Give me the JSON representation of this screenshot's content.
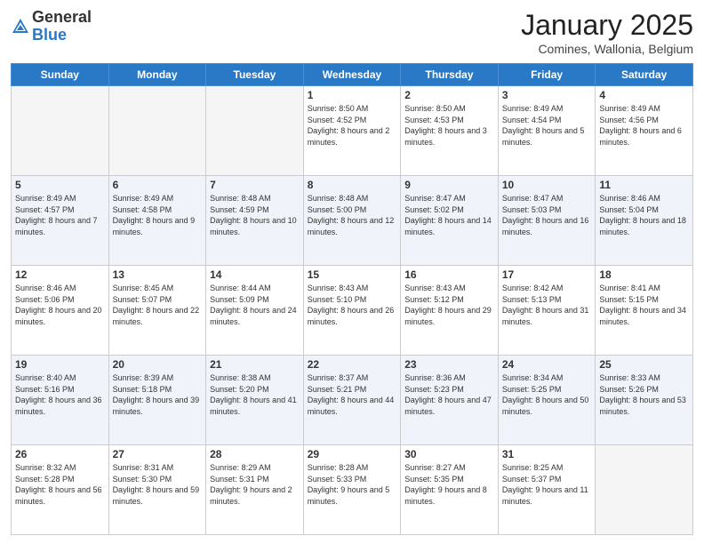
{
  "logo": {
    "general": "General",
    "blue": "Blue"
  },
  "title": "January 2025",
  "subtitle": "Comines, Wallonia, Belgium",
  "days_of_week": [
    "Sunday",
    "Monday",
    "Tuesday",
    "Wednesday",
    "Thursday",
    "Friday",
    "Saturday"
  ],
  "weeks": [
    [
      {
        "day": "",
        "empty": true
      },
      {
        "day": "",
        "empty": true
      },
      {
        "day": "",
        "empty": true
      },
      {
        "day": "1",
        "sunrise": "8:50 AM",
        "sunset": "4:52 PM",
        "daylight": "8 hours and 2 minutes."
      },
      {
        "day": "2",
        "sunrise": "8:50 AM",
        "sunset": "4:53 PM",
        "daylight": "8 hours and 3 minutes."
      },
      {
        "day": "3",
        "sunrise": "8:49 AM",
        "sunset": "4:54 PM",
        "daylight": "8 hours and 5 minutes."
      },
      {
        "day": "4",
        "sunrise": "8:49 AM",
        "sunset": "4:56 PM",
        "daylight": "8 hours and 6 minutes."
      }
    ],
    [
      {
        "day": "5",
        "sunrise": "8:49 AM",
        "sunset": "4:57 PM",
        "daylight": "8 hours and 7 minutes."
      },
      {
        "day": "6",
        "sunrise": "8:49 AM",
        "sunset": "4:58 PM",
        "daylight": "8 hours and 9 minutes."
      },
      {
        "day": "7",
        "sunrise": "8:48 AM",
        "sunset": "4:59 PM",
        "daylight": "8 hours and 10 minutes."
      },
      {
        "day": "8",
        "sunrise": "8:48 AM",
        "sunset": "5:00 PM",
        "daylight": "8 hours and 12 minutes."
      },
      {
        "day": "9",
        "sunrise": "8:47 AM",
        "sunset": "5:02 PM",
        "daylight": "8 hours and 14 minutes."
      },
      {
        "day": "10",
        "sunrise": "8:47 AM",
        "sunset": "5:03 PM",
        "daylight": "8 hours and 16 minutes."
      },
      {
        "day": "11",
        "sunrise": "8:46 AM",
        "sunset": "5:04 PM",
        "daylight": "8 hours and 18 minutes."
      }
    ],
    [
      {
        "day": "12",
        "sunrise": "8:46 AM",
        "sunset": "5:06 PM",
        "daylight": "8 hours and 20 minutes."
      },
      {
        "day": "13",
        "sunrise": "8:45 AM",
        "sunset": "5:07 PM",
        "daylight": "8 hours and 22 minutes."
      },
      {
        "day": "14",
        "sunrise": "8:44 AM",
        "sunset": "5:09 PM",
        "daylight": "8 hours and 24 minutes."
      },
      {
        "day": "15",
        "sunrise": "8:43 AM",
        "sunset": "5:10 PM",
        "daylight": "8 hours and 26 minutes."
      },
      {
        "day": "16",
        "sunrise": "8:43 AM",
        "sunset": "5:12 PM",
        "daylight": "8 hours and 29 minutes."
      },
      {
        "day": "17",
        "sunrise": "8:42 AM",
        "sunset": "5:13 PM",
        "daylight": "8 hours and 31 minutes."
      },
      {
        "day": "18",
        "sunrise": "8:41 AM",
        "sunset": "5:15 PM",
        "daylight": "8 hours and 34 minutes."
      }
    ],
    [
      {
        "day": "19",
        "sunrise": "8:40 AM",
        "sunset": "5:16 PM",
        "daylight": "8 hours and 36 minutes."
      },
      {
        "day": "20",
        "sunrise": "8:39 AM",
        "sunset": "5:18 PM",
        "daylight": "8 hours and 39 minutes."
      },
      {
        "day": "21",
        "sunrise": "8:38 AM",
        "sunset": "5:20 PM",
        "daylight": "8 hours and 41 minutes."
      },
      {
        "day": "22",
        "sunrise": "8:37 AM",
        "sunset": "5:21 PM",
        "daylight": "8 hours and 44 minutes."
      },
      {
        "day": "23",
        "sunrise": "8:36 AM",
        "sunset": "5:23 PM",
        "daylight": "8 hours and 47 minutes."
      },
      {
        "day": "24",
        "sunrise": "8:34 AM",
        "sunset": "5:25 PM",
        "daylight": "8 hours and 50 minutes."
      },
      {
        "day": "25",
        "sunrise": "8:33 AM",
        "sunset": "5:26 PM",
        "daylight": "8 hours and 53 minutes."
      }
    ],
    [
      {
        "day": "26",
        "sunrise": "8:32 AM",
        "sunset": "5:28 PM",
        "daylight": "8 hours and 56 minutes."
      },
      {
        "day": "27",
        "sunrise": "8:31 AM",
        "sunset": "5:30 PM",
        "daylight": "8 hours and 59 minutes."
      },
      {
        "day": "28",
        "sunrise": "8:29 AM",
        "sunset": "5:31 PM",
        "daylight": "9 hours and 2 minutes."
      },
      {
        "day": "29",
        "sunrise": "8:28 AM",
        "sunset": "5:33 PM",
        "daylight": "9 hours and 5 minutes."
      },
      {
        "day": "30",
        "sunrise": "8:27 AM",
        "sunset": "5:35 PM",
        "daylight": "9 hours and 8 minutes."
      },
      {
        "day": "31",
        "sunrise": "8:25 AM",
        "sunset": "5:37 PM",
        "daylight": "9 hours and 11 minutes."
      },
      {
        "day": "",
        "empty": true
      }
    ]
  ]
}
